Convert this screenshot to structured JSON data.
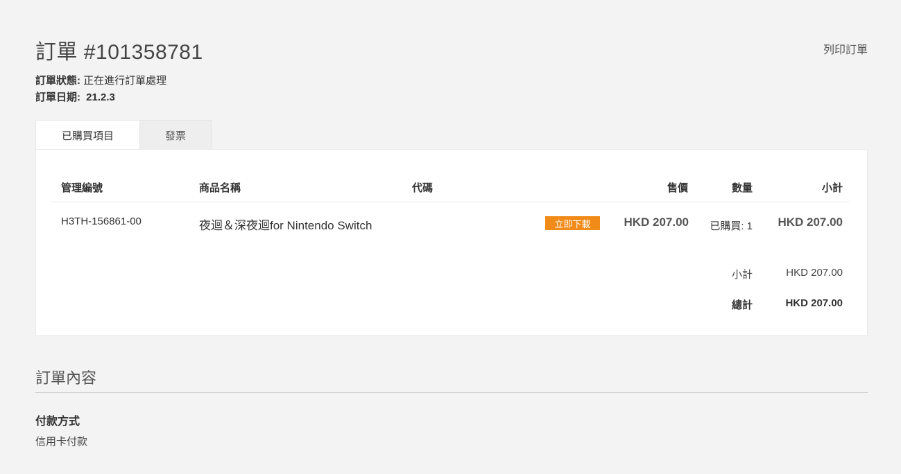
{
  "header": {
    "title": "訂單 #101358781",
    "print_label": "列印訂單"
  },
  "meta": {
    "status_label": "訂單狀態:",
    "status_value": "正在進行訂單處理",
    "date_label": "訂單日期:",
    "date_value": "21.2.3"
  },
  "tabs": [
    {
      "label": "已購買項目",
      "active": true
    },
    {
      "label": "發票",
      "active": false
    }
  ],
  "table": {
    "columns": [
      "管理編號",
      "商品名稱",
      "代碼",
      "售價",
      "數量",
      "小計"
    ],
    "rows": [
      {
        "sku": "H3TH-156861-00",
        "name": "夜迴＆深夜迴for Nintendo Switch",
        "download_label": "立即下載",
        "price": "HKD 207.00",
        "qty": "已購買: 1",
        "subtotal": "HKD 207.00"
      }
    ],
    "totals": {
      "subtotal_label": "小計",
      "subtotal_value": "HKD 207.00",
      "grand_label": "總計",
      "grand_value": "HKD 207.00"
    }
  },
  "order_info": {
    "section_title": "訂單內容",
    "payment_label": "付款方式",
    "payment_value": "信用卡付款"
  },
  "colors": {
    "accent": "#f08b1a",
    "background": "#f4f3f3"
  }
}
